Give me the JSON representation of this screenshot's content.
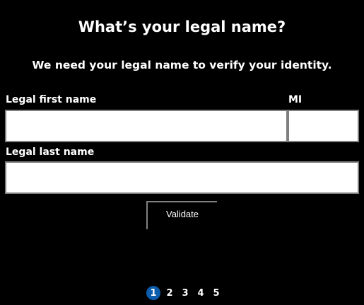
{
  "header": {
    "title": "What’s your legal name?",
    "subtitle": "We need your legal name to verify your identity."
  },
  "form": {
    "first_name": {
      "label": "Legal first name",
      "value": "",
      "placeholder": ""
    },
    "middle_initial": {
      "label": "MI",
      "value": "",
      "placeholder": ""
    },
    "last_name": {
      "label": "Legal last name",
      "value": "",
      "placeholder": ""
    },
    "validate_label": "Validate"
  },
  "pagination": {
    "pages": [
      "1",
      "2",
      "3",
      "4",
      "5"
    ],
    "current": "1"
  },
  "colors": {
    "background": "#000000",
    "text": "#ffffff",
    "input_background": "#ffffff",
    "input_border": "#808080",
    "active_page": "#0b5cad"
  }
}
